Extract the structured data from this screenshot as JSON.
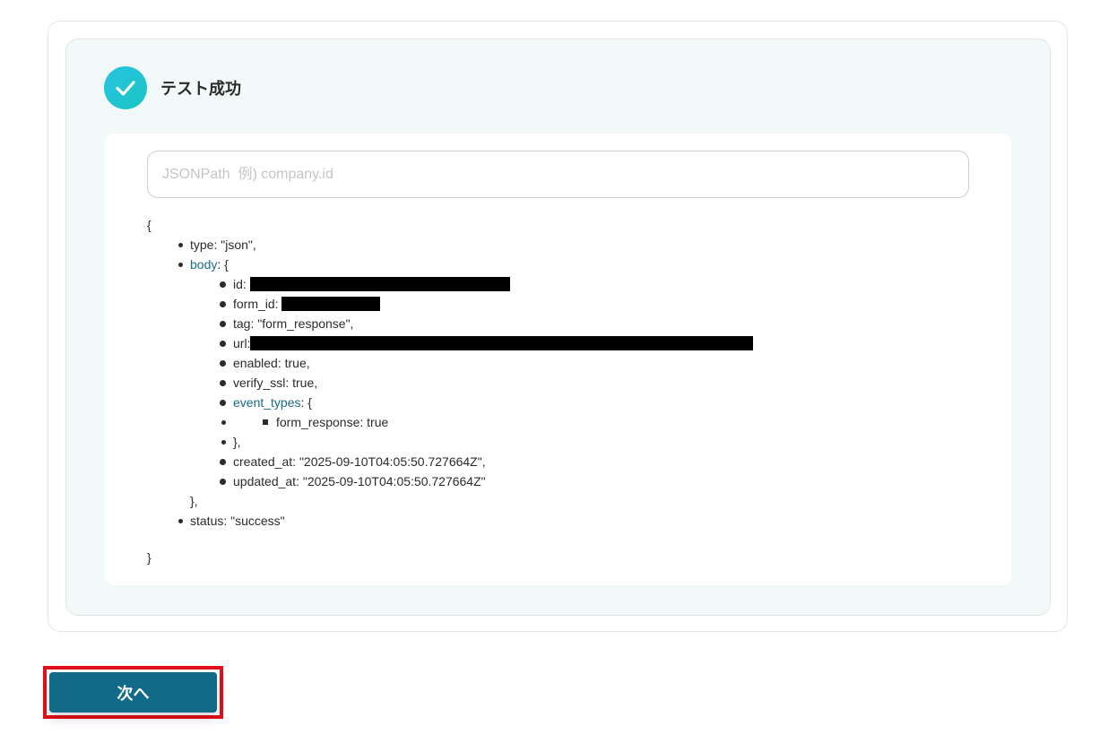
{
  "status": {
    "icon": "check-circle-icon",
    "title": "テスト成功"
  },
  "jsonpath": {
    "placeholder": "JSONPath  例) company.id",
    "value": ""
  },
  "json": {
    "open_brace": "{",
    "type_line": "type: \"json\",",
    "body_key": "body",
    "body_open": ": {",
    "body_items": {
      "id_label": "id:",
      "form_id_label": "form_id:",
      "tag_line": "tag: \"form_response\",",
      "url_label": "url:",
      "enabled_line": "enabled: true,",
      "verify_ssl_line": "verify_ssl: true,",
      "event_types_key": "event_types",
      "event_types_open": ": {",
      "form_response_line": "form_response: true",
      "event_types_close": "},",
      "created_at_line": "created_at: \"2025-09-10T04:05:50.727664Z\",",
      "updated_at_line": "updated_at: \"2025-09-10T04:05:50.727664Z\""
    },
    "body_close": "},",
    "status_line": "status: \"success\"",
    "close_brace": "}"
  },
  "footer": {
    "next_label": "次へ"
  },
  "colors": {
    "accent": "#106a88",
    "highlight_border": "#e3101a",
    "success_gradient_start": "#28c3e3",
    "success_gradient_end": "#19c5c0",
    "panel_bg": "#f2f9f8",
    "link_key": "#1a6a86"
  }
}
